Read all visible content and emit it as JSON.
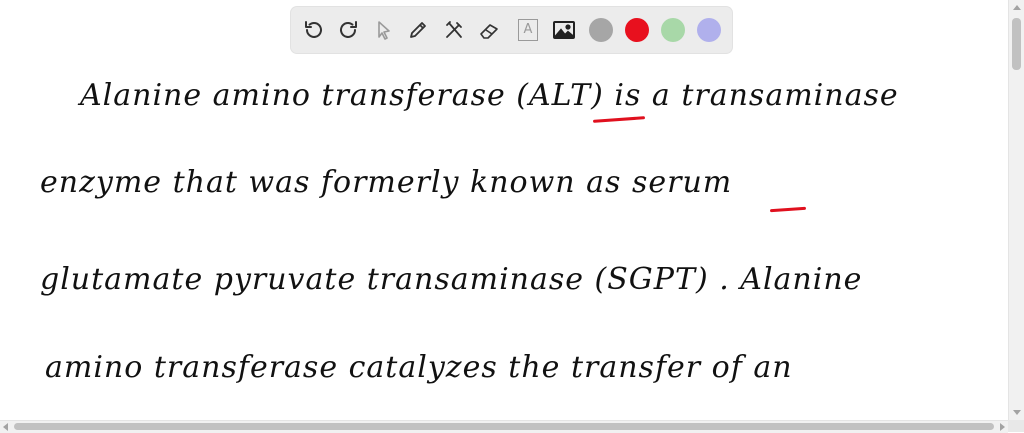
{
  "toolbar": {
    "tools": [
      {
        "name": "undo-icon"
      },
      {
        "name": "redo-icon"
      },
      {
        "name": "select-arrow-icon"
      },
      {
        "name": "pencil-icon"
      },
      {
        "name": "tools-icon"
      },
      {
        "name": "eraser-icon"
      },
      {
        "name": "text-icon"
      },
      {
        "name": "image-icon"
      }
    ],
    "colors": [
      "#a6a6a6",
      "#e8101e",
      "#a8d8a8",
      "#b0b0ec"
    ],
    "text_tool_label": "A"
  },
  "note": {
    "lines": [
      "Alanine   amino   transferase   (ALT)   is   a   transaminase",
      "enzyme   that   was   formerly   known   as   serum",
      "glutamate   pyruvate   transaminase  (SGPT) .  Alanine",
      "amino  transferase   catalyzes   the   transfer   of   an"
    ]
  }
}
